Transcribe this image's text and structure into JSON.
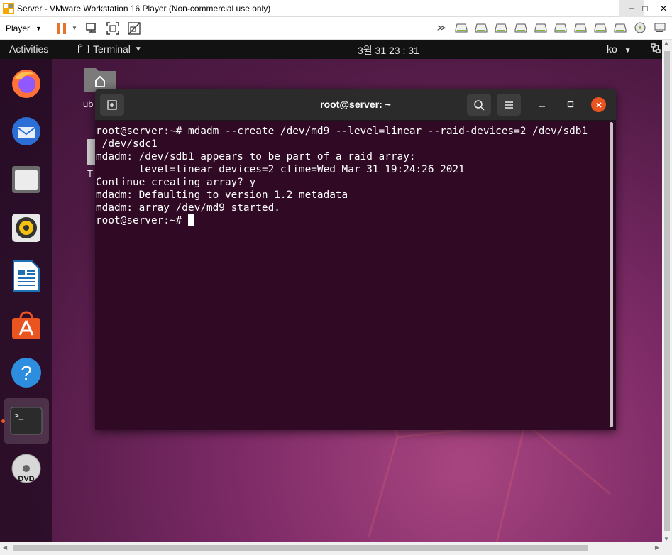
{
  "vmware": {
    "window_title": "Server - VMware Workstation 16 Player (Non-commercial use only)",
    "player_menu_label": "Player",
    "controls": {
      "minimize": "−",
      "maximize": "□",
      "close": "✕"
    }
  },
  "ubuntu": {
    "activities_label": "Activities",
    "app_menu_label": "Terminal",
    "clock": "3월 31  23 : 31",
    "input_lang": "ko",
    "desktop": {
      "home_label": "ub",
      "trash_label": "T"
    },
    "dock": [
      "firefox",
      "thunderbird",
      "files",
      "rhythmbox",
      "libreoffice-writer",
      "ubuntu-software",
      "help",
      "terminal",
      "dvd"
    ]
  },
  "terminal": {
    "title": "root@server: ~",
    "lines": [
      "root@server:~# mdadm --create /dev/md9 --level=linear --raid-devices=2 /dev/sdb1",
      " /dev/sdc1",
      "mdadm: /dev/sdb1 appears to be part of a raid array:",
      "       level=linear devices=2 ctime=Wed Mar 31 19:24:26 2021",
      "Continue creating array? y",
      "mdadm: Defaulting to version 1.2 metadata",
      "mdadm: array /dev/md9 started."
    ],
    "prompt": "root@server:~# "
  },
  "colors": {
    "accent": "#e95420",
    "terminal_bg": "#300a24",
    "topbar_bg": "#121212"
  }
}
